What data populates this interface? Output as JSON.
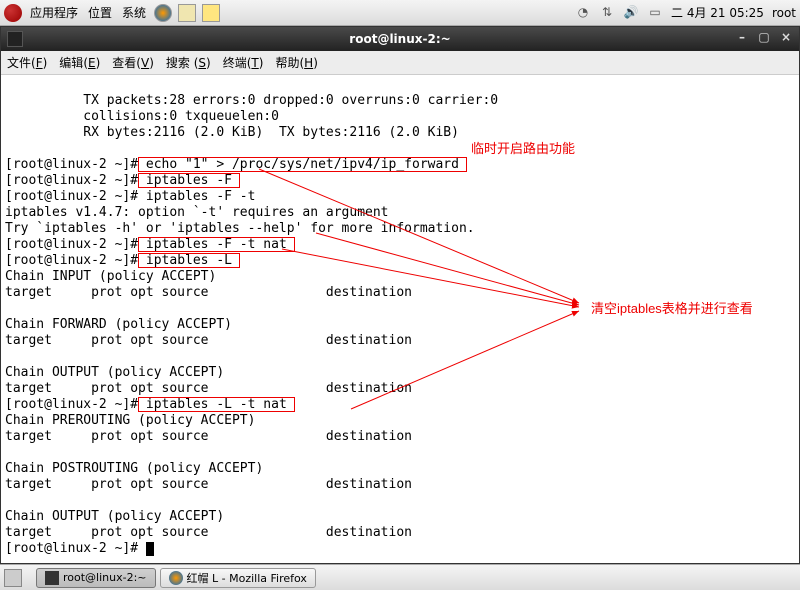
{
  "panel": {
    "menus": [
      "应用程序",
      "位置",
      "系统"
    ],
    "clock": "二  4月 21 05:25",
    "user": "root"
  },
  "window": {
    "title": "root@linux-2:~",
    "menus": [
      {
        "label": "文件",
        "accel": "F"
      },
      {
        "label": "编辑",
        "accel": "E"
      },
      {
        "label": "查看",
        "accel": "V"
      },
      {
        "label": "搜索",
        "accel": "S"
      },
      {
        "label": "终端",
        "accel": "T"
      },
      {
        "label": "帮助",
        "accel": "H"
      }
    ]
  },
  "term": {
    "indent": "          ",
    "prompt": "[root@linux-2 ~]#",
    "stats": [
      "TX packets:28 errors:0 dropped:0 overruns:0 carrier:0",
      "collisions:0 txqueuelen:0",
      "RX bytes:2116 (2.0 KiB)  TX bytes:2116 (2.0 KiB)"
    ],
    "cmds": {
      "c1": " echo \"1\" > /proc/sys/net/ipv4/ip_forward ",
      "c2": " iptables -F ",
      "c3": " iptables -F -t",
      "c3err": "iptables v1.4.7: option `-t' requires an argument",
      "c3hint": "Try `iptables -h' or 'iptables --help' for more information.",
      "c4": " iptables -F -t nat ",
      "c5": " iptables -L ",
      "c6": " iptables -L -t nat "
    },
    "chains": {
      "input": "Chain INPUT (policy ACCEPT)",
      "fwd": "Chain FORWARD (policy ACCEPT)",
      "out": "Chain OUTPUT (policy ACCEPT)",
      "pre": "Chain PREROUTING (policy ACCEPT)",
      "post": "Chain POSTROUTING (policy ACCEPT)",
      "header": "target     prot opt source               destination"
    }
  },
  "annotations": {
    "a1": "临时开启路由功能",
    "a2": "清空iptables表格并进行查看"
  },
  "taskbar": {
    "t1": "root@linux-2:~",
    "t2": "红帽 L - Mozilla Firefox"
  }
}
